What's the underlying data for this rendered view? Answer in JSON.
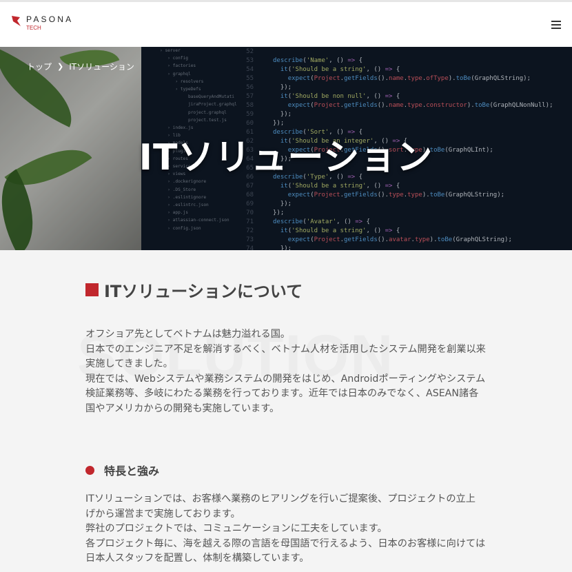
{
  "header": {
    "logo_name": "PASONA",
    "logo_sub": "TECH"
  },
  "breadcrumb": {
    "home": "トップ",
    "separator": "❯",
    "current": "ITソリューション"
  },
  "hero": {
    "title": "ITソリューション",
    "file_tree": [
      "server",
      "config",
      "factories",
      "graphql",
      "resolvers",
      "typeDefs",
      "baseQueryAndMutati",
      "jiraProject.graphql",
      "project.graphql",
      "project.test.js",
      "index.js",
      "lib",
      "models",
      "plugins",
      "routes",
      "services",
      "views",
      ".dockerignore",
      ".DS_Store",
      ".eslintignore",
      ".eslintrc.json",
      "app.js",
      "atlassian-connect.json",
      "config.json"
    ],
    "line_numbers": [
      "52",
      "53",
      "54",
      "55",
      "56",
      "57",
      "58",
      "59",
      "60",
      "61",
      "62",
      "63",
      "64",
      "65",
      "66",
      "67",
      "68",
      "69",
      "70",
      "71",
      "72",
      "73",
      "74",
      "75",
      "76",
      "77",
      "78"
    ]
  },
  "section": {
    "heading": "ITソリューションについて",
    "watermark": "SOLUTION",
    "paragraph1": [
      "オフショア先としてベトナムは魅力溢れる国。",
      "日本でのエンジニア不足を解消するべく、ベトナム人材を活用したシステム開発を創業以来",
      "実施してきました。",
      "現在では、Webシステムや業務システムの開発をはじめ、Androidポーティングやシステム",
      "検証業務等、多岐にわたる業務を行っております。近年では日本のみでなく、ASEAN諸各",
      "国やアメリカからの開発も実施しています。"
    ],
    "subheading": "特長と強み",
    "paragraph2": [
      "ITソリューションでは、お客様へ業務のヒアリングを行いご提案後、プロジェクトの立上",
      "げから運営まで実施しております。",
      "弊社のプロジェクトでは、コミュニケーションに工夫をしています。",
      "各プロジェクト毎に、海を越える際の言語を母国語で行えるよう、日本のお客様に向けては",
      "日本人スタッフを配置し、体制を構築しています。"
    ]
  },
  "colors": {
    "accent": "#c1272d"
  },
  "icons": {
    "menu": "hamburger-menu-icon",
    "logo": "pasona-logo-icon"
  }
}
